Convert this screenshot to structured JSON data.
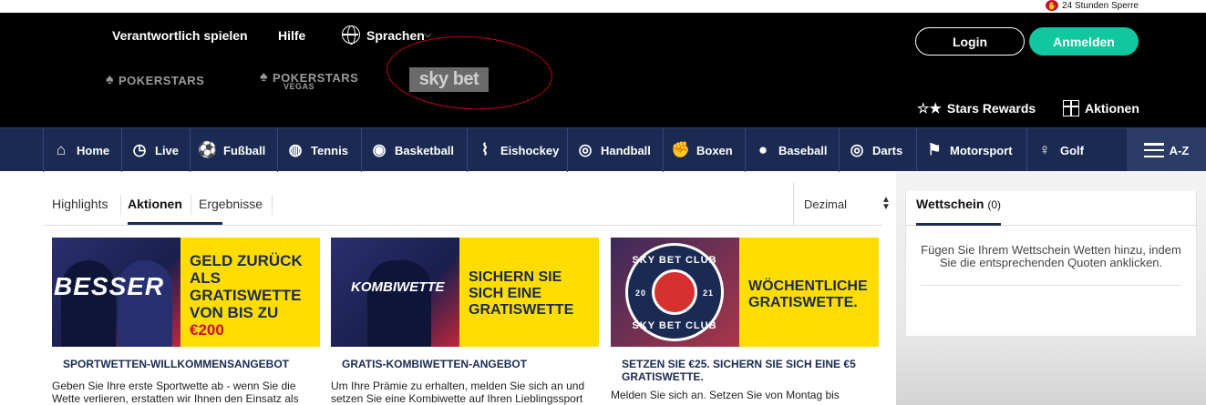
{
  "top": {
    "sperre": "24 Stunden Sperre",
    "util_links": [
      "Verantwortlich spielen",
      "Hilfe",
      "Sprachen"
    ],
    "brands": {
      "pokerstars": "POKERSTARS",
      "pokerstars_vegas": "POKERSTARS",
      "vegas_sub": "VEGAS",
      "skybet": "sky bet"
    },
    "login": "Login",
    "register": "Anmelden",
    "rewards": "Stars Rewards",
    "aktionen": "Aktionen"
  },
  "sportnav": {
    "items": [
      "Home",
      "Live",
      "Fußball",
      "Tennis",
      "Basketball",
      "Eishockey",
      "Handball",
      "Boxen",
      "Baseball",
      "Darts",
      "Motorsport",
      "Golf"
    ],
    "az": "A-Z"
  },
  "tabs": {
    "items": [
      "Highlights",
      "Aktionen",
      "Ergebnisse"
    ],
    "odds_format": "Dezimal"
  },
  "promos": [
    {
      "overlay": "BESSER",
      "banner_text": "GELD ZURÜCK ALS GRATISWETTE VON BIS ZU",
      "amount": "€200",
      "heading": "SPORTWETTEN-WILLKOMMENSANGEBOT",
      "body": "Geben Sie Ihre erste Sportwette ab - wenn Sie die Wette verlieren, erstatten wir Ihnen den Einsatz als"
    },
    {
      "overlay": "KOMBIWETTE",
      "banner_text": "SICHERN SIE SICH EINE GRATISWETTE",
      "heading": "GRATIS-KOMBIWETTEN-ANGEBOT",
      "body": "Um Ihre Prämie zu erhalten, melden Sie sich an und setzen Sie eine Kombiwette auf Ihren Lieblingssport"
    },
    {
      "club_top": "SKY BET CLUB",
      "club_bottom": "SKY BET CLUB",
      "club_year_left": "20",
      "club_year_right": "21",
      "banner_text": "WÖCHENTLICHE GRATISWETTE.",
      "heading": "SETZEN SIE €25. SICHERN SIE SICH EINE €5 GRATISWETTE.",
      "body": "Melden Sie sich an. Setzen Sie von Montag bis"
    }
  ],
  "betslip": {
    "title": "Wettschein",
    "count": "(0)",
    "message": "Fügen Sie Ihrem Wettschein Wetten hinzu, indem Sie die entsprechenden Quoten anklicken."
  },
  "colors": {
    "nav_bg": "#1b2a52",
    "accent_teal": "#10c7a0",
    "promo_yellow": "#ffdd00",
    "annotation_red": "#c0001a"
  }
}
